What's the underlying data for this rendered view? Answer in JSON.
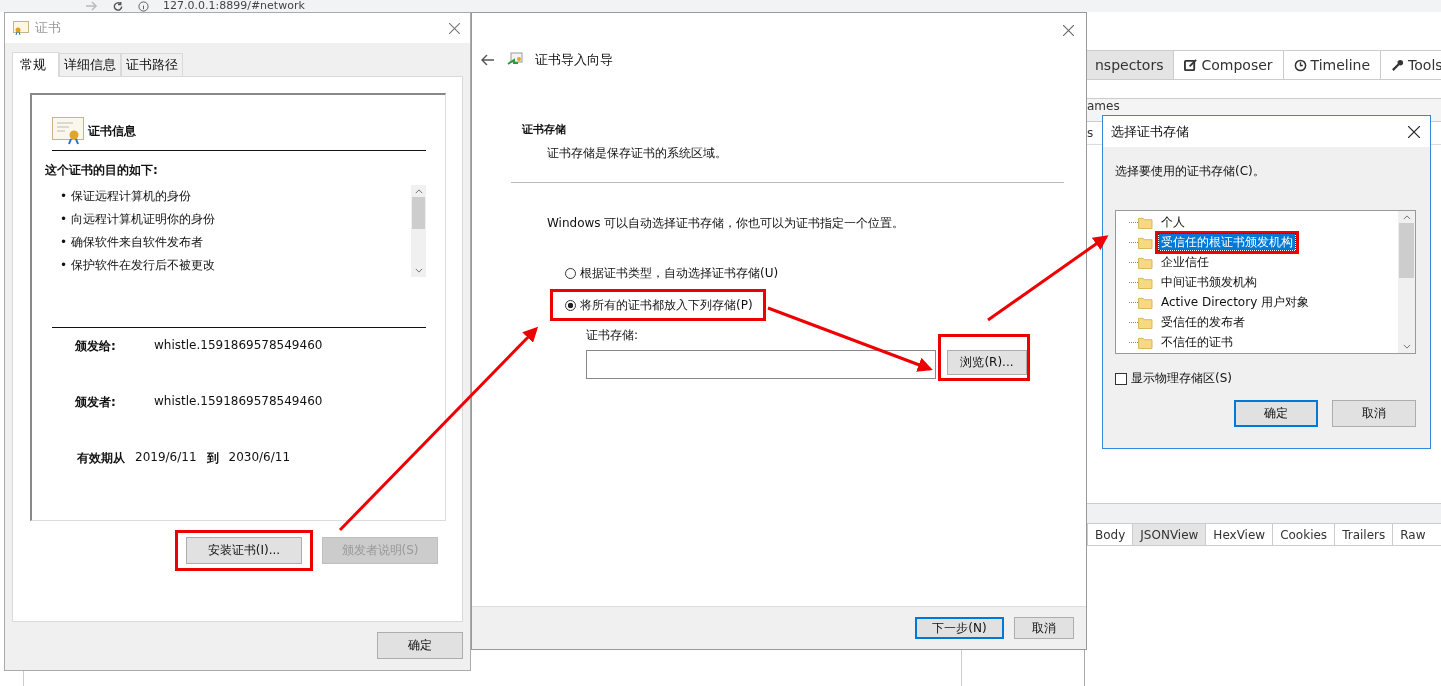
{
  "browser": {
    "address": "127.0.0.1:8899/#network"
  },
  "inspector": {
    "tabs": [
      {
        "label": "nspectors",
        "selected": true
      },
      {
        "label": "Composer",
        "selected": false
      },
      {
        "label": "Timeline",
        "selected": false
      },
      {
        "label": "Tools",
        "selected": false
      }
    ],
    "fragments": [
      "ames",
      "s"
    ],
    "response_tabs": [
      {
        "label": "Body",
        "selected": false
      },
      {
        "label": "JSONView",
        "selected": true
      },
      {
        "label": "HexView",
        "selected": false
      },
      {
        "label": "Cookies",
        "selected": false
      },
      {
        "label": "Trailers",
        "selected": false
      },
      {
        "label": "Raw",
        "selected": false
      }
    ]
  },
  "cert_dialog": {
    "title": "证书",
    "tabs": [
      {
        "label": "常规",
        "selected": true
      },
      {
        "label": "详细信息",
        "selected": false
      },
      {
        "label": "证书路径",
        "selected": false
      }
    ],
    "heading": "证书信息",
    "purpose_title": "这个证书的目的如下:",
    "purposes": [
      "• 保证远程计算机的身份",
      "• 向远程计算机证明你的身份",
      "• 确保软件来自软件发布者",
      "• 保护软件在发行后不被更改"
    ],
    "fields": [
      {
        "label": "颁发给:",
        "value": "whistle.1591869578549460"
      },
      {
        "label": "颁发者:",
        "value": "whistle.1591869578549460"
      }
    ],
    "validity": {
      "label": "有效期从",
      "from": "2019/6/11",
      "to_label": "到",
      "to": "2030/6/11"
    },
    "buttons": [
      {
        "label": "安装证书(I)...",
        "disabled": false,
        "highlighted": true
      },
      {
        "label": "颁发者说明(S)",
        "disabled": true,
        "highlighted": false
      }
    ],
    "ok_button": "确定"
  },
  "wizard": {
    "title": "证书导入向导",
    "section_title": "证书存储",
    "section_desc": "证书存储是保存证书的系统区域。",
    "intro": "Windows 可以自动选择证书存储，你也可以为证书指定一个位置。",
    "options": [
      {
        "label": "根据证书类型，自动选择证书存储(U)",
        "selected": false,
        "highlighted": false
      },
      {
        "label": "将所有的证书都放入下列存储(P)",
        "selected": true,
        "highlighted": true
      }
    ],
    "store_label": "证书存储:",
    "browse_button": {
      "label": "浏览(R)...",
      "highlighted": true
    },
    "buttons": [
      {
        "label": "下一步(N)",
        "default": true
      },
      {
        "label": "取消",
        "default": false
      }
    ]
  },
  "store_dialog": {
    "title": "选择证书存储",
    "prompt": "选择要使用的证书存储(C)。",
    "stores": [
      {
        "label": "个人",
        "selected": false,
        "highlighted": false
      },
      {
        "label": "受信任的根证书颁发机构",
        "selected": true,
        "highlighted": true
      },
      {
        "label": "企业信任",
        "selected": false,
        "highlighted": false
      },
      {
        "label": "中间证书颁发机构",
        "selected": false,
        "highlighted": false
      },
      {
        "label": "Active Directory 用户对象",
        "selected": false,
        "highlighted": false
      },
      {
        "label": "受信任的发布者",
        "selected": false,
        "highlighted": false
      },
      {
        "label": "不信任的证书",
        "selected": false,
        "highlighted": false
      }
    ],
    "show_physical": {
      "label": "显示物理存储区(S)",
      "checked": false
    },
    "buttons": [
      {
        "label": "确定",
        "default": true
      },
      {
        "label": "取消",
        "default": false
      }
    ]
  },
  "annotations": {
    "arrows": true
  }
}
